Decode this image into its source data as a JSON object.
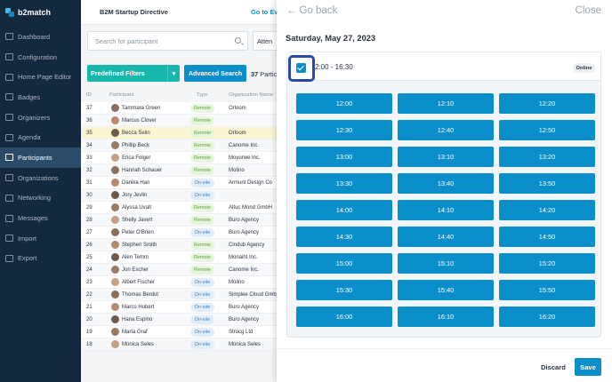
{
  "app": {
    "brand": "b2match"
  },
  "colors": {
    "sidebar": "#13293d",
    "primary": "#0b8fcb",
    "teal": "#17b7ad",
    "focus": "#2948a9"
  },
  "sidebar": {
    "items": [
      {
        "label": "Dashboard",
        "icon": "dashboard-icon"
      },
      {
        "label": "Configuration",
        "icon": "configuration-icon"
      },
      {
        "label": "Home Page Editor",
        "icon": "home-page-editor-icon"
      },
      {
        "label": "Badges",
        "icon": "badge-icon"
      },
      {
        "label": "Organizers",
        "icon": "organizers-icon"
      },
      {
        "label": "Agenda",
        "icon": "agenda-icon"
      },
      {
        "label": "Participants",
        "icon": "participants-icon",
        "active": true
      },
      {
        "label": "Organizations",
        "icon": "organizations-icon"
      },
      {
        "label": "Networking",
        "icon": "networking-icon"
      },
      {
        "label": "Messages",
        "icon": "messages-icon"
      },
      {
        "label": "Import",
        "icon": "import-icon"
      },
      {
        "label": "Export",
        "icon": "export-icon"
      }
    ]
  },
  "topbar": {
    "title": "B2M Startup Directive",
    "goto": "Go to Ev"
  },
  "list": {
    "search_placeholder": "Search for participant",
    "attend": "Atten",
    "filter_label": "Predefined Filters",
    "advanced_label": "Advanced Search",
    "count": "37",
    "count_suffix": " Partic",
    "columns": {
      "id": "ID",
      "participant": "Participant",
      "type": "Type",
      "org": "Organization Name"
    },
    "rows": [
      {
        "id": "37",
        "name": "Tammara Green",
        "type": "Remote",
        "org": "Orloom"
      },
      {
        "id": "36",
        "name": "Marcus Clover",
        "type": "Remote",
        "org": ""
      },
      {
        "id": "35",
        "name": "Becca Selin",
        "type": "Remote",
        "org": "Orloom",
        "highlight": true
      },
      {
        "id": "34",
        "name": "Phillip Beck",
        "type": "Remote",
        "org": "Canome Inc."
      },
      {
        "id": "33",
        "name": "Erica Folger",
        "type": "Remote",
        "org": "Moyurwe Inc."
      },
      {
        "id": "32",
        "name": "Hannah Schauer",
        "type": "Remote",
        "org": "Molino"
      },
      {
        "id": "31",
        "name": "Danika Han",
        "type": "On-site",
        "org": "Armunt Design Co"
      },
      {
        "id": "30",
        "name": "Jory Jevlin",
        "type": "On-site",
        "org": ""
      },
      {
        "id": "29",
        "name": "Alyssa Uvalt",
        "type": "Remote",
        "org": "Altuc Mond GmbH"
      },
      {
        "id": "28",
        "name": "Shelly Javert",
        "type": "Remote",
        "org": "Buro Agency"
      },
      {
        "id": "27",
        "name": "Peter O'Brien",
        "type": "On-site",
        "org": "Buro Agency"
      },
      {
        "id": "26",
        "name": "Stephen Smith",
        "type": "Remote",
        "org": "Cindub Agency"
      },
      {
        "id": "25",
        "name": "Alen Temm",
        "type": "Remote",
        "org": "Monaiht Inc."
      },
      {
        "id": "24",
        "name": "Jon Escher",
        "type": "Remote",
        "org": "Canome Inc."
      },
      {
        "id": "23",
        "name": "Albert Fischer",
        "type": "On-site",
        "org": "Molino"
      },
      {
        "id": "22",
        "name": "Thomas Berdut",
        "type": "On-site",
        "org": "Simplee Cloud Gmb"
      },
      {
        "id": "21",
        "name": "Marco Hubert",
        "type": "On-site",
        "org": "Buro Agency"
      },
      {
        "id": "20",
        "name": "Hana Espino",
        "type": "On-site",
        "org": "Buro Agency"
      },
      {
        "id": "19",
        "name": "Marta Graf",
        "type": "On-site",
        "org": "Strucg Ltd"
      },
      {
        "id": "18",
        "name": "Monica Seles",
        "type": "On-site",
        "org": "Monica Seles"
      }
    ]
  },
  "panel": {
    "back": "Go back",
    "close": "Close",
    "date": "Saturday, May 27, 2023",
    "range": "2:00 - 16:30",
    "badge": "Online",
    "slots": [
      "12:00",
      "12:10",
      "12:20",
      "12:30",
      "12:40",
      "12:50",
      "13:00",
      "13:10",
      "13:20",
      "13:30",
      "13:40",
      "13:50",
      "14:00",
      "14:10",
      "14:20",
      "14:30",
      "14:40",
      "14:50",
      "15:00",
      "15:10",
      "15:20",
      "15:30",
      "15:40",
      "15:50",
      "16:00",
      "16:10",
      "16:20"
    ],
    "discard": "Discard",
    "save": "Save"
  }
}
